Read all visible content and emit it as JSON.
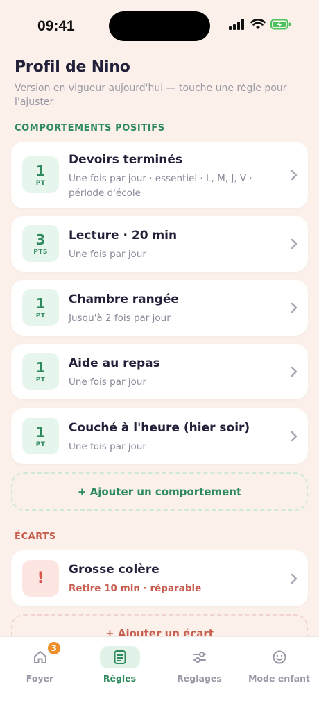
{
  "status": {
    "time": "09:41"
  },
  "header": {
    "title": "Profil de Nino",
    "subtitle": "Version en vigueur aujourd'hui — touche une règle pour l'ajuster"
  },
  "positive": {
    "section_label": "COMPORTEMENTS POSITIFS",
    "items": [
      {
        "points": "1",
        "unit": "PT",
        "title": "Devoirs terminés",
        "subtitle": "Une fois par jour · essentiel · L, M, J, V · période d'école"
      },
      {
        "points": "3",
        "unit": "PTS",
        "title": "Lecture · 20 min",
        "subtitle": "Une fois par jour"
      },
      {
        "points": "1",
        "unit": "PT",
        "title": "Chambre rangée",
        "subtitle": "Jusqu'à 2 fois par jour"
      },
      {
        "points": "1",
        "unit": "PT",
        "title": "Aide au repas",
        "subtitle": "Une fois par jour"
      },
      {
        "points": "1",
        "unit": "PT",
        "title": "Couché à l'heure (hier soir)",
        "subtitle": "Une fois par jour"
      }
    ],
    "add_label": "+ Ajouter un comportement"
  },
  "negative": {
    "section_label": "ÉCARTS",
    "items": [
      {
        "symbol": "!",
        "title": "Grosse colère",
        "subtitle": "Retire 10 min · réparable"
      }
    ],
    "add_label": "+ Ajouter un écart"
  },
  "tabbar": {
    "tabs": [
      {
        "label": "Foyer",
        "icon": "home-icon",
        "badge": "3"
      },
      {
        "label": "Règles",
        "icon": "rules-icon",
        "active": true
      },
      {
        "label": "Réglages",
        "icon": "sliders-icon"
      },
      {
        "label": "Mode enfant",
        "icon": "smiley-icon"
      }
    ]
  },
  "colors": {
    "positive": "#2f8a5e",
    "negative": "#c75d4f",
    "background": "#fbf1ea",
    "badge": "#ee8f2a"
  }
}
